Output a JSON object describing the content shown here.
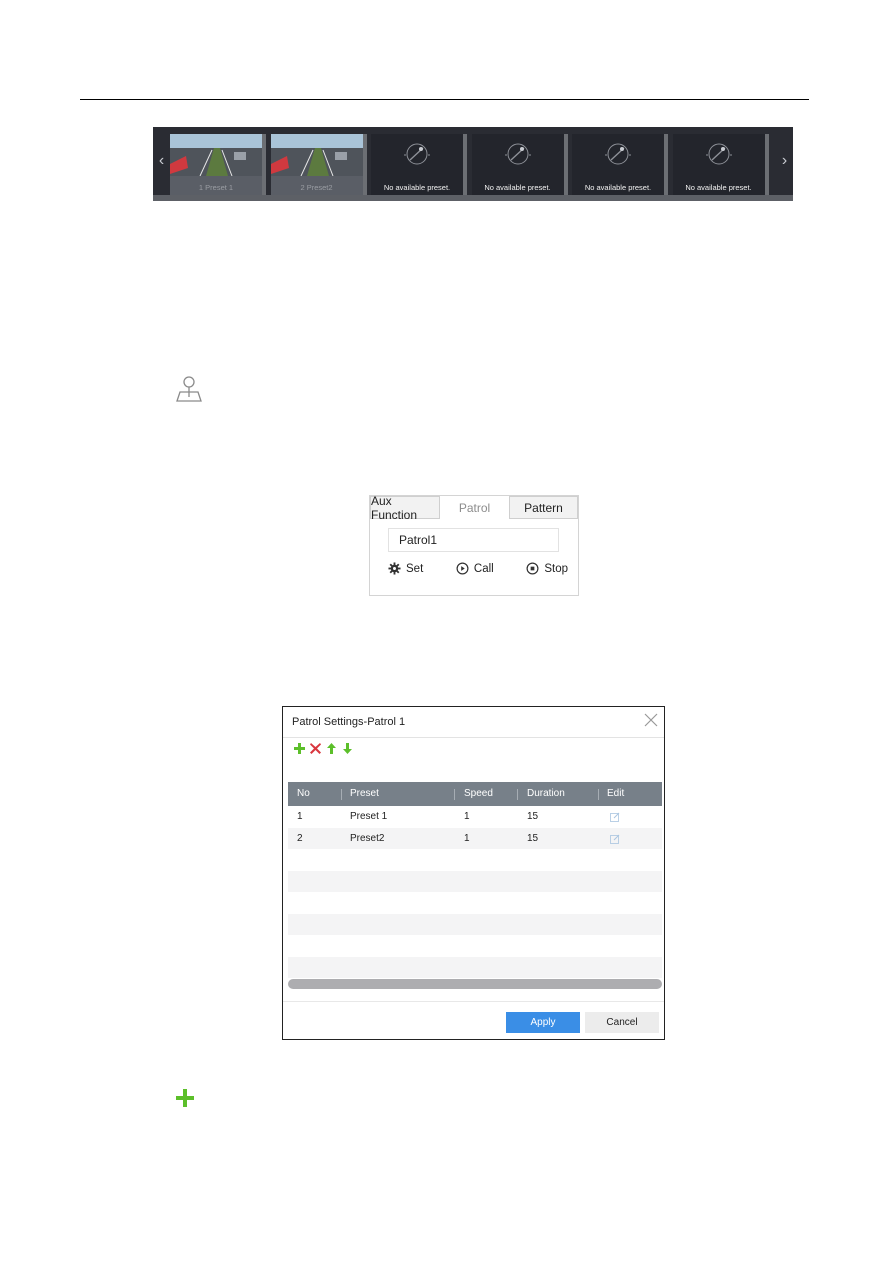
{
  "preset_strip": {
    "thumbnails": [
      {
        "caption": "1 Preset 1",
        "has_image": true
      },
      {
        "caption": "2 Preset2",
        "has_image": true
      },
      {
        "caption": "No available preset.",
        "has_image": false
      },
      {
        "caption": "No available preset.",
        "has_image": false
      },
      {
        "caption": "No available preset.",
        "has_image": false
      },
      {
        "caption": "No available preset.",
        "has_image": false
      }
    ],
    "prev_icon": "chevron-left-icon",
    "next_icon": "chevron-right-icon"
  },
  "icons": {
    "preset_pin": "map-pin-icon",
    "add": "plus-icon"
  },
  "ptz_panel": {
    "tabs": [
      {
        "label": "Aux Function",
        "active": false
      },
      {
        "label": "Patrol",
        "active": true
      },
      {
        "label": "Pattern",
        "active": false
      }
    ],
    "patrol_value": "Patrol1",
    "actions": [
      {
        "label": "Set",
        "icon": "gear-icon"
      },
      {
        "label": "Call",
        "icon": "play-circle-icon"
      },
      {
        "label": "Stop",
        "icon": "stop-circle-icon"
      }
    ]
  },
  "dialog": {
    "title": "Patrol Settings-Patrol 1",
    "toolbar": [
      "add-icon",
      "delete-icon",
      "move-up-icon",
      "move-down-icon"
    ],
    "columns": [
      "No",
      "Preset",
      "Speed",
      "Duration",
      "Edit"
    ],
    "rows": [
      {
        "no": "1",
        "preset": "Preset 1",
        "speed": "1",
        "duration": "15"
      },
      {
        "no": "2",
        "preset": "Preset2",
        "speed": "1",
        "duration": "15"
      }
    ],
    "empty_rows": 6,
    "apply_label": "Apply",
    "cancel_label": "Cancel",
    "colors": {
      "header": "#778089",
      "apply": "#3a8ee6"
    }
  }
}
